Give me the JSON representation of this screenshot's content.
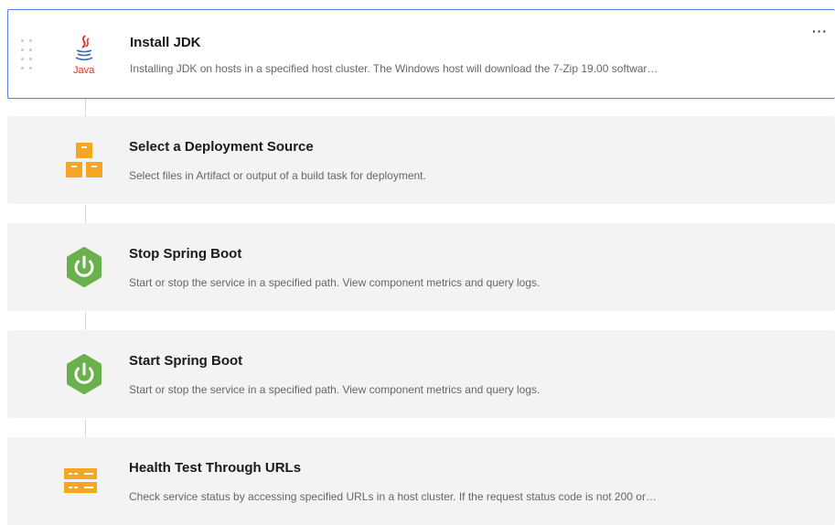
{
  "steps": [
    {
      "title": "Install JDK",
      "description": "Installing JDK on hosts in a specified host cluster. The Windows host will download the 7-Zip 19.00 softwar…",
      "icon": "java-icon",
      "icon_text": "Java",
      "selected": true,
      "more_label": "···"
    },
    {
      "title": "Select a Deployment Source",
      "description": "Select files in Artifact or output of a build task for deployment.",
      "icon": "boxes-icon"
    },
    {
      "title": "Stop Spring Boot",
      "description": "Start or stop the service in a specified path. View component metrics and query logs.",
      "icon": "power-icon"
    },
    {
      "title": "Start Spring Boot",
      "description": "Start or stop the service in a specified path. View component metrics and query logs.",
      "icon": "power-icon"
    },
    {
      "title": "Health Test Through URLs",
      "description": "Check service status by accessing specified URLs in a host cluster. If the request status code is not 200 or…",
      "icon": "server-icon"
    }
  ],
  "colors": {
    "selected_border": "#5b7fe0",
    "card_background": "#f3f3f4",
    "orange": "#f5a623",
    "green": "#6ab04c",
    "java_red": "#e4312b",
    "java_blue": "#3a6fb0"
  }
}
